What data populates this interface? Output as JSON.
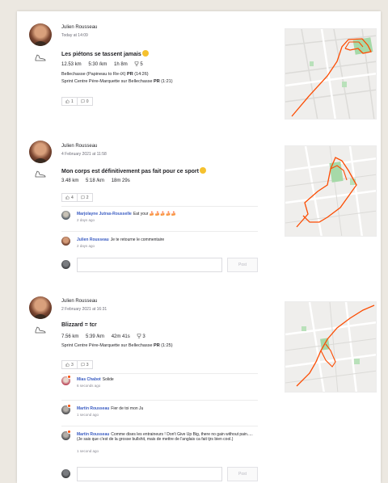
{
  "colors": {
    "accent": "#fc4c02",
    "link": "#3a5cc2",
    "background": "#ece8e1"
  },
  "post_button_label": "Post",
  "activities": [
    {
      "athlete": "Julien Rousseau",
      "date": "Today at 14:09",
      "title": "Les piétons se tassent jamais",
      "title_emoji": "grinning-face-emoji",
      "stats": {
        "distance": "12.53 km",
        "pace": "5:30 /km",
        "time": "1h 8m",
        "achievements": "5"
      },
      "segments": [
        {
          "text": "Bellechasse (Papineau to Re-iX)",
          "badge": "PR",
          "time": "(14:26)"
        },
        {
          "text": "Sprint Centre Père-Marquette sur Bellechasse",
          "badge": "PR",
          "time": "(1:21)"
        }
      ],
      "kudos": "1",
      "comments_count": "0",
      "comments": []
    },
    {
      "athlete": "Julien Rousseau",
      "date": "4 February 2021 at 11:58",
      "title": "Mon corps est définitivement pas fait pour ce sport",
      "title_emoji": "grinning-face-emoji",
      "stats": {
        "distance": "3.48 km",
        "pace": "5:18 /km",
        "time": "18m 29s"
      },
      "segments": [],
      "kudos": "4",
      "comments_count": "2",
      "comments": [
        {
          "author": "Marjolayne Jutras-Rousselle",
          "text": "Eat your",
          "emojis": "🍰🍰🍰🍰🍰",
          "time": "2 days ago",
          "avatar": "marjo"
        },
        {
          "author": "Julien Rousseau",
          "text": "Je te retourne le commentaire",
          "time": "2 days ago",
          "avatar": "julien"
        }
      ]
    },
    {
      "athlete": "Julien Rousseau",
      "date": "2 February 2021 at 16:31",
      "title": "Blizzard = tcr",
      "stats": {
        "distance": "7.56 km",
        "pace": "5:39 /km",
        "time": "42m 41s",
        "achievements": "3"
      },
      "segments": [
        {
          "text": "Sprint Centre Père-Marquette sur Bellechasse",
          "badge": "PR",
          "time": "(1:25)"
        }
      ],
      "kudos": "3",
      "comments_count": "3",
      "comments": [
        {
          "author": "Mias Chabot",
          "text": "Solide",
          "time": "6 seconds ago",
          "avatar": "mias"
        },
        {
          "author": "Martin Rousseau",
          "text": "Fier de toi mon Ju",
          "time": "1 second ago",
          "avatar": "martin"
        },
        {
          "author": "Martin Rousseau",
          "text": "Comme dises les entraineurs ! Don't Give Up Big, there no gain without pain.....(Je sais que c'est de la grosse bullshit, mais de mettre de l'anglais ca fait tjrs bien cool.)",
          "time": "1 second ago",
          "avatar": "martin"
        }
      ]
    }
  ]
}
